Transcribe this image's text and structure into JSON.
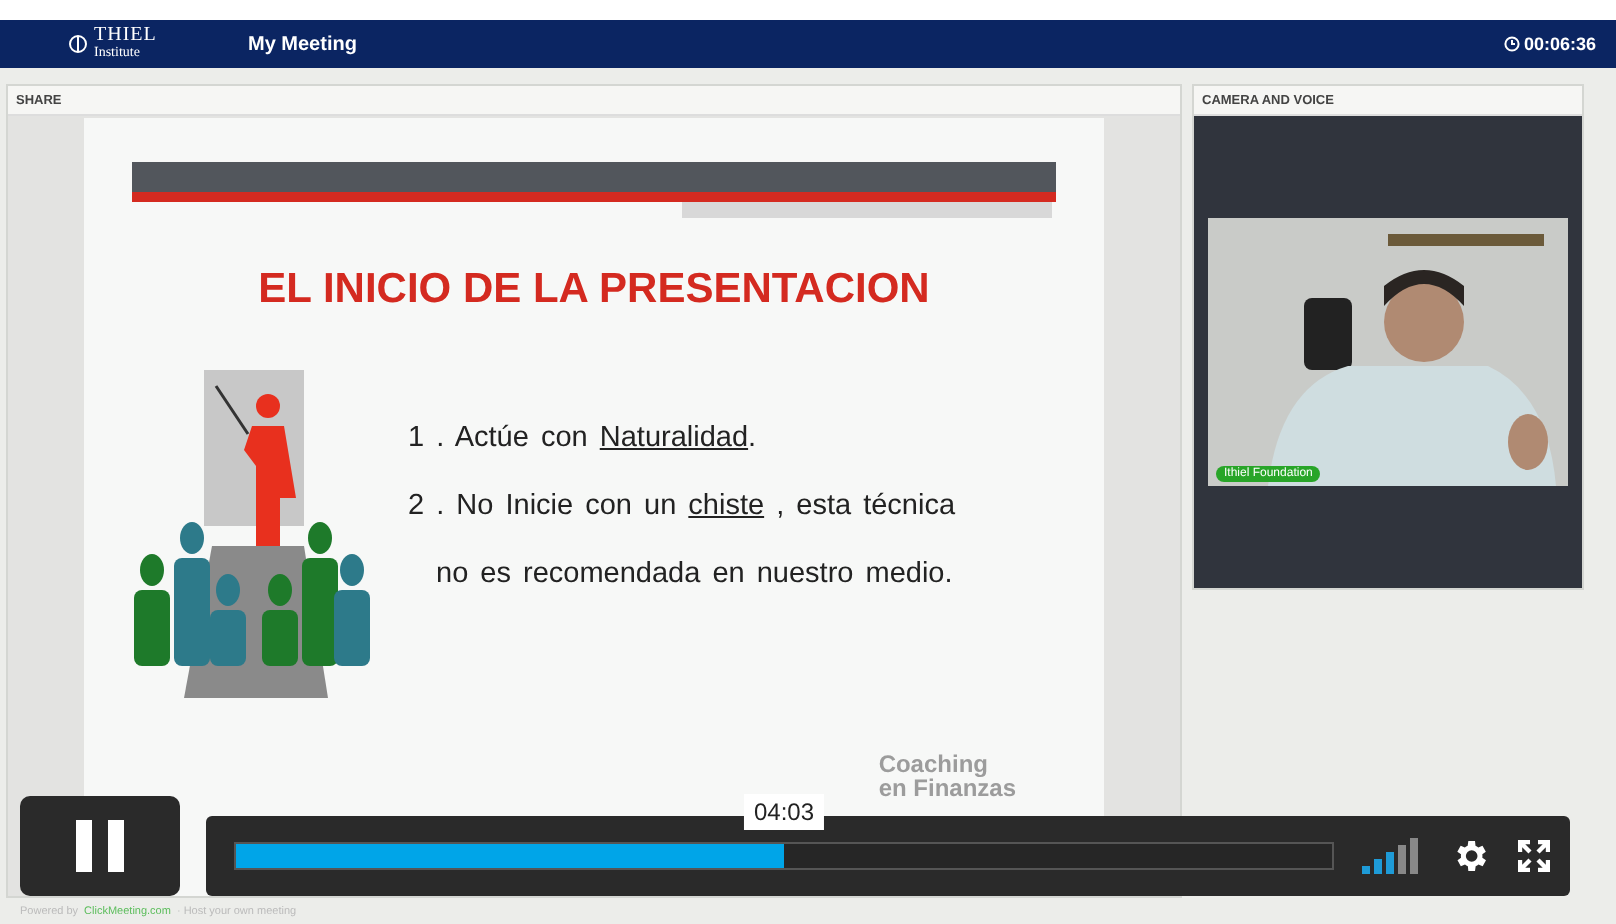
{
  "header": {
    "logo": {
      "mark": "THIEL",
      "sub": "Institute"
    },
    "title": "My Meeting",
    "timer": "00:06:36"
  },
  "share": {
    "title": "SHARE",
    "slide": {
      "heading": "EL INICIO DE LA PRESENTACION",
      "items": [
        {
          "number": "1 .",
          "segments": [
            {
              "text": "Actúe con ",
              "underlined": false
            },
            {
              "text": "Naturalidad",
              "underlined": true
            },
            {
              "text": ".",
              "underlined": false
            }
          ]
        },
        {
          "number": "2 .",
          "segments": [
            {
              "text": "No Inicie con un ",
              "underlined": false
            },
            {
              "text": "chiste",
              "underlined": true
            },
            {
              "text": " , esta técnica",
              "underlined": false
            }
          ]
        },
        {
          "segments": [
            {
              "text": "no es recomendada en nuestro medio.",
              "underlined": false
            }
          ]
        }
      ],
      "logo": [
        "Coaching",
        "en Finanzas"
      ]
    }
  },
  "camera": {
    "title": "CAMERA AND VOICE",
    "video": {
      "kind": "picture",
      "label": "Ithiel Foundation"
    }
  },
  "footer": {
    "prefix": "Powered by",
    "link": "ClickMeeting.com",
    "suffix": "· Host your own meeting"
  },
  "player": {
    "playing": true,
    "time": "04:03",
    "level": 0.5
  }
}
